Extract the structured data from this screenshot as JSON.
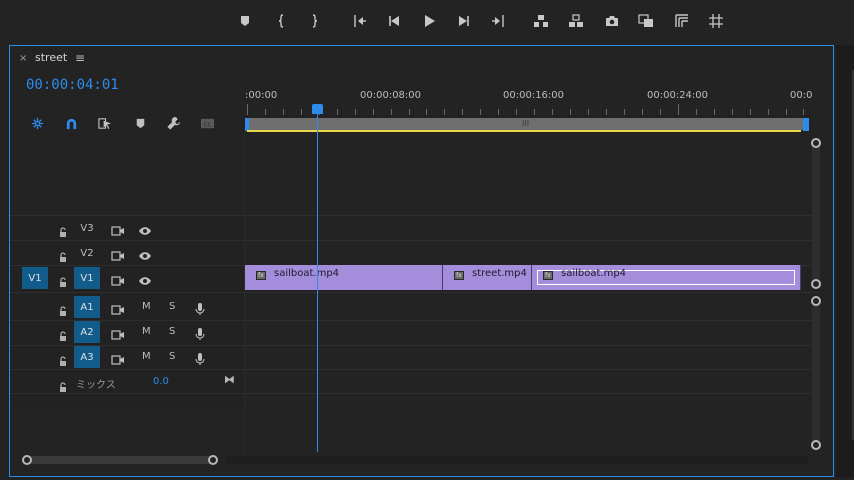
{
  "sequence": {
    "tab_close": "×",
    "tab_title": "street",
    "tab_menu": "≡",
    "timecode": "00:00:04:01"
  },
  "ruler": {
    "labels": [
      ":00:00",
      "00:00:08:00",
      "00:00:16:00",
      "00:00:24:00",
      "00:0"
    ],
    "zoom_grip": "III"
  },
  "tracks": {
    "video": [
      {
        "name": "V3",
        "source": ""
      },
      {
        "name": "V2",
        "source": ""
      },
      {
        "name": "V1",
        "source": "V1"
      }
    ],
    "audio": [
      {
        "name": "A1",
        "mute": "M",
        "solo": "S"
      },
      {
        "name": "A2",
        "mute": "M",
        "solo": "S"
      },
      {
        "name": "A3",
        "mute": "M",
        "solo": "S"
      }
    ],
    "mix": {
      "label": "ミックス",
      "value": "0.0"
    }
  },
  "clips": [
    {
      "name": "sailboat.mp4",
      "fx": "fx"
    },
    {
      "name": "street.mp4",
      "fx": "fx"
    },
    {
      "name": "sailboat.mp4",
      "fx": "fx"
    }
  ],
  "colors": {
    "accent": "#2d8ceb",
    "clip": "#a48ddb",
    "track_target": "#125c8c",
    "work_area": "#e7d84a"
  },
  "icons": {
    "transport": [
      "marker-icon",
      "mark-in-icon",
      "mark-out-icon",
      "go-to-in-icon",
      "step-back-icon",
      "play-icon",
      "step-forward-icon",
      "go-to-out-icon",
      "lift-icon",
      "extract-icon",
      "camera-icon",
      "compare-icon",
      "safe-margins-icon",
      "grid-icon"
    ],
    "tools": [
      "nest-icon",
      "snap-icon",
      "linked-selection-icon",
      "add-marker-icon",
      "wrench-icon",
      "captions-icon"
    ]
  }
}
